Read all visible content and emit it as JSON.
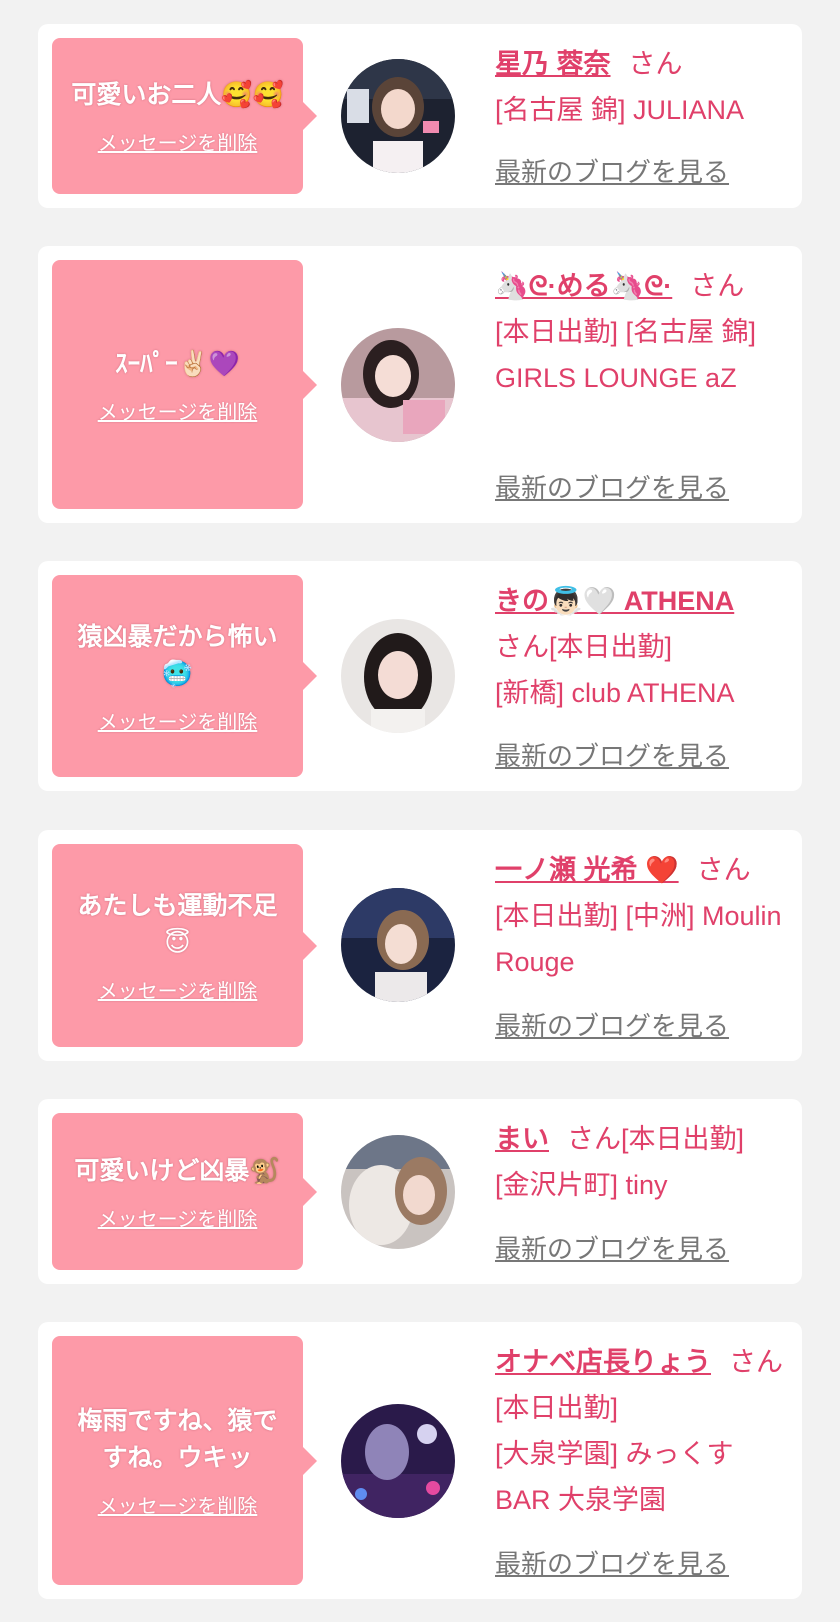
{
  "accent_color": "#e0406a",
  "bubble_color": "#fd9aa8",
  "cards": [
    {
      "message": "可愛いお二人🥰🥰",
      "delete_label": "メッセージを削除",
      "name": "星乃 蓉奈",
      "suffix": "さん",
      "details": "[名古屋 錦] JULIANA",
      "blog_label": "最新のブログを見る"
    },
    {
      "message": "ｽｰﾊﾟｰ✌🏻💜",
      "delete_label": "メッセージを削除",
      "name": "🦄ᘓ·める🦄ᘓ·",
      "suffix": "さん",
      "details": "[本日出勤] [名古屋 錦] GIRLS LOUNGE aZ",
      "blog_label": "最新のブログを見る"
    },
    {
      "message": "猿凶暴だから怖い🥶",
      "delete_label": "メッセージを削除",
      "name": "きの👼🏻🤍 ATHENA",
      "suffix": "さん[本日出勤]",
      "details": "[新橋] club ATHENA",
      "blog_label": "最新のブログを見る"
    },
    {
      "message": "あたしも運動不足😇",
      "delete_label": "メッセージを削除",
      "name": "一ノ瀬 光希 ❤️",
      "suffix": "さん",
      "details": "[本日出勤] [中洲] Moulin Rouge",
      "blog_label": "最新のブログを見る"
    },
    {
      "message": "可愛いけど凶暴🐒",
      "delete_label": "メッセージを削除",
      "name": "まい",
      "suffix": "さん[本日出勤]",
      "details": "[金沢片町] tiny",
      "blog_label": "最新のブログを見る"
    },
    {
      "message": "梅雨ですね、猿ですね。ウキッ",
      "delete_label": "メッセージを削除",
      "name": "オナベ店長りょう",
      "suffix": "さん[本日出勤]",
      "details": "[大泉学園] みっくすBAR 大泉学園",
      "blog_label": "最新のブログを見る"
    }
  ]
}
